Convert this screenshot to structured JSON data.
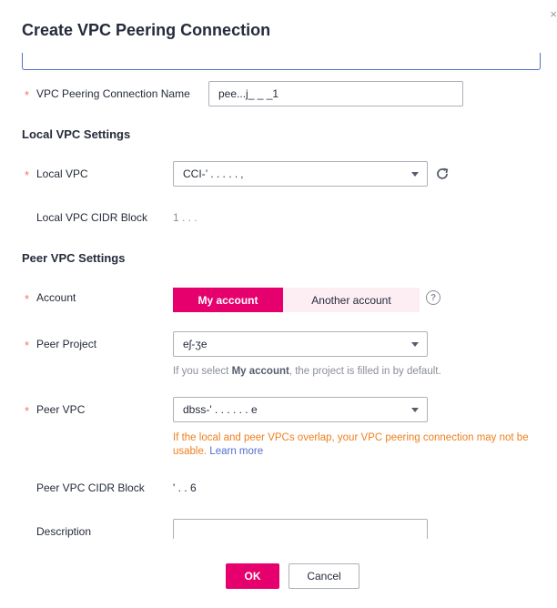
{
  "dialog": {
    "title": "Create VPC Peering Connection",
    "close_glyph": "×"
  },
  "form": {
    "required_mark": "*",
    "name_label": "VPC Peering Connection Name",
    "name_value": "pee...j_ _ _1",
    "local_section": "Local VPC Settings",
    "local_vpc_label": "Local VPC",
    "local_vpc_value": "CCI-’ . . . . .  ‚",
    "local_cidr_label": "Local VPC CIDR Block",
    "local_cidr_value": "1 .  .  .",
    "peer_section": "Peer VPC Settings",
    "account_label": "Account",
    "account_options": [
      "My account",
      "Another account"
    ],
    "account_selected": "My account",
    "peer_project_label": "Peer Project",
    "peer_project_value": "eʃ-ʒe",
    "hint_prefix": "If you select ",
    "hint_bold": "My account",
    "hint_suffix": ", the project is filled in by default.",
    "peer_vpc_label": "Peer VPC",
    "peer_vpc_value": "dbss-' . . . . . .  e",
    "warning_text": "If the local and peer VPCs overlap, your VPC peering connection may not be usable.",
    "learn_more": "Learn more",
    "peer_cidr_label": "Peer VPC CIDR Block",
    "peer_cidr_value": "' .  .  6",
    "description_label": "Description"
  },
  "footer": {
    "ok_label": "OK",
    "cancel_label": "Cancel"
  },
  "colors": {
    "brand": "#e6006e",
    "required": "#f66f6a",
    "warning": "#ee8020",
    "link": "#526ecc"
  },
  "icons": {
    "refresh": "refresh-icon",
    "help": "help-icon",
    "caret": "chevron-down-icon"
  }
}
